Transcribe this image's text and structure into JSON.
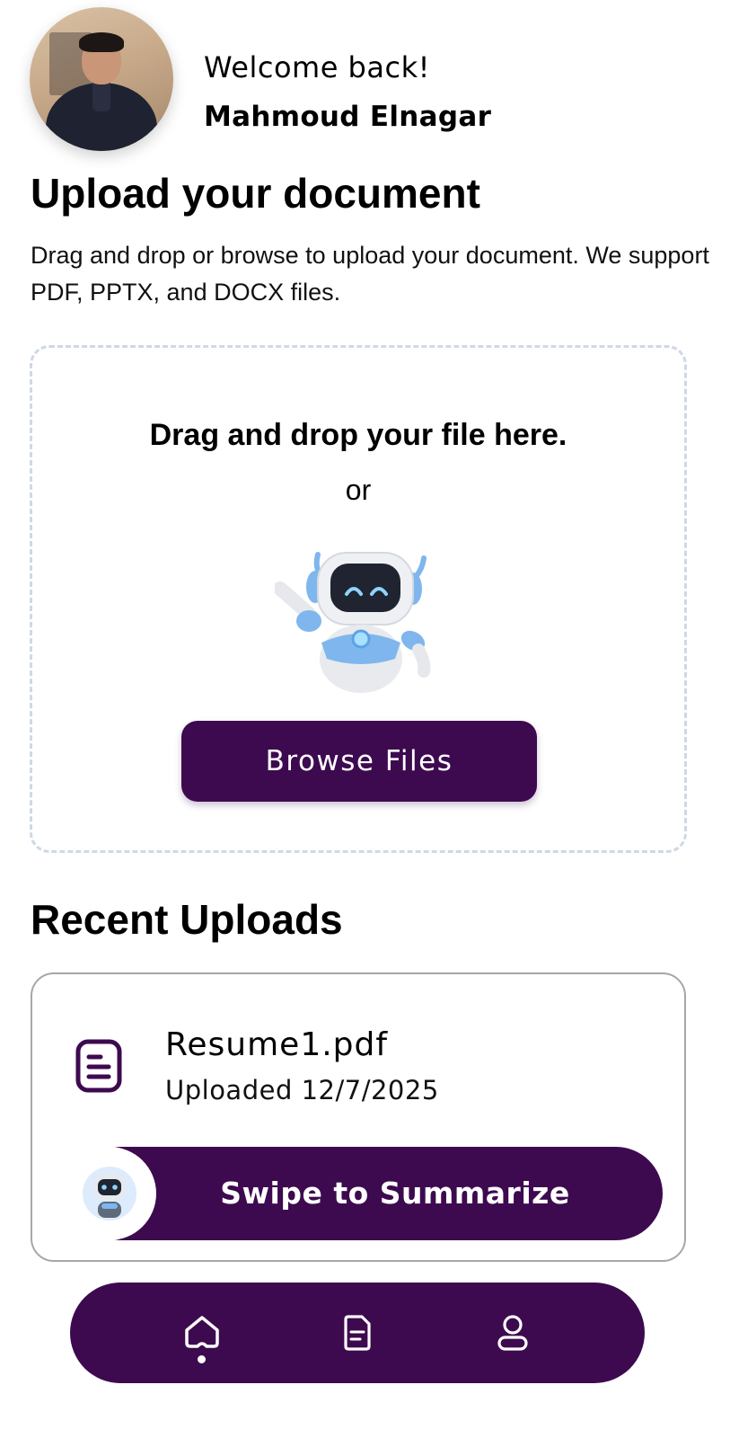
{
  "header": {
    "welcome": "Welcome back!",
    "username": "Mahmoud Elnagar"
  },
  "upload": {
    "title": "Upload your document",
    "description": "Drag and drop or browse to upload your document. We support PDF, PPTX, and DOCX files.",
    "drop_title": "Drag and drop your file here.",
    "or": "or",
    "browse_label": "Browse Files"
  },
  "recent": {
    "title": "Recent Uploads",
    "items": [
      {
        "file_name": "Resume1.pdf",
        "uploaded": "Uploaded 12/7/2025",
        "swipe_label": "Swipe to Summarize"
      }
    ]
  },
  "nav": {
    "items": [
      {
        "icon": "home-icon",
        "active": true
      },
      {
        "icon": "document-icon",
        "active": false
      },
      {
        "icon": "profile-icon",
        "active": false
      }
    ]
  },
  "colors": {
    "primary": "#3d0a4f",
    "dashed_border": "#cfd8e6",
    "robot_blue": "#7fb6ee"
  }
}
